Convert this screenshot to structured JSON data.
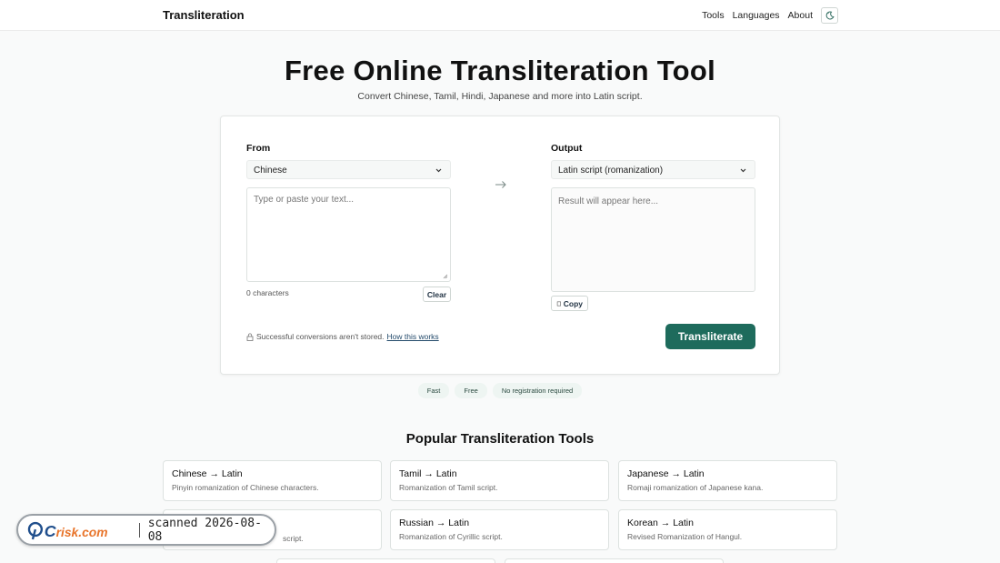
{
  "header": {
    "brand": "Transliteration",
    "nav": [
      "Tools",
      "Languages",
      "About"
    ]
  },
  "hero": {
    "title": "Free Online Transliteration Tool",
    "subtitle": "Convert Chinese, Tamil, Hindi, Japanese and more into Latin script."
  },
  "converter": {
    "from_label": "From",
    "from_value": "Chinese",
    "input_placeholder": "Type or paste your text...",
    "char_count": "0 characters",
    "clear_label": "Clear",
    "output_label": "Output",
    "output_value": "Latin script (romanization)",
    "output_placeholder": "Result will appear here...",
    "copy_label": "Copy",
    "notice_text": "Successful conversions aren't stored.",
    "notice_link": "How this works",
    "submit_label": "Transliterate"
  },
  "badges": [
    "Fast",
    "Free",
    "No registration required"
  ],
  "popular": {
    "title": "Popular Transliteration Tools",
    "tools": [
      {
        "title": "Chinese → Latin",
        "desc": "Pinyin romanization of Chinese characters."
      },
      {
        "title": "Tamil → Latin",
        "desc": "Romanization of Tamil script."
      },
      {
        "title": "Japanese → Latin",
        "desc": "Romaji romanization of Japanese kana."
      },
      {
        "title": "",
        "desc": "script."
      },
      {
        "title": "Russian → Latin",
        "desc": "Romanization of Cyrillic script."
      },
      {
        "title": "Korean → Latin",
        "desc": "Revised Romanization of Hangul."
      }
    ]
  },
  "watermark": {
    "logo": "PCrisk.com",
    "text": "scanned 2026-08-08"
  },
  "colors": {
    "accent": "#1e6b5c",
    "border": "#dde2e0"
  }
}
